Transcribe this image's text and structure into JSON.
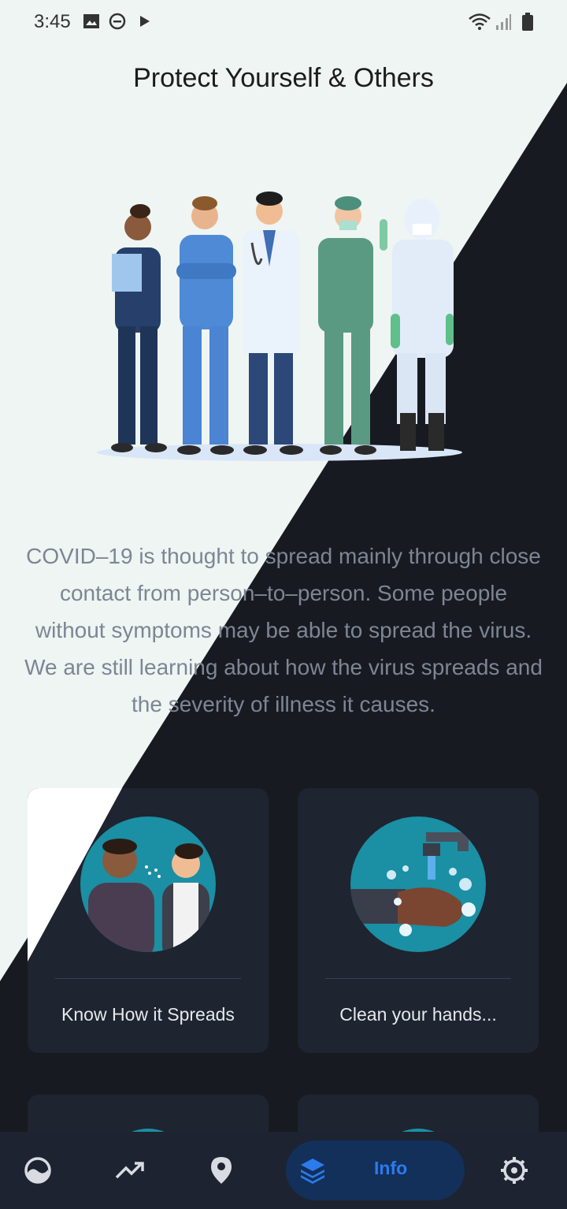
{
  "status_bar": {
    "time": "3:45"
  },
  "page": {
    "title": "Protect Yourself & Others",
    "description": "COVID–19 is thought to spread mainly through close contact from person–to–person. Some people without symptoms may be able to spread the virus. We are still learning about how the virus spreads and the severity of illness it causes."
  },
  "cards": [
    {
      "label": "Know How it Spreads",
      "icon": "people-sneezing-illustration"
    },
    {
      "label": "Clean your hands...",
      "icon": "handwashing-illustration"
    }
  ],
  "nav": {
    "items": [
      {
        "name": "overview",
        "icon": "globe-icon"
      },
      {
        "name": "trends",
        "icon": "trending-up-icon"
      },
      {
        "name": "map",
        "icon": "location-pin-icon"
      },
      {
        "name": "info",
        "icon": "layers-icon",
        "label": "Info",
        "active": true
      },
      {
        "name": "settings",
        "icon": "gear-icon"
      }
    ]
  },
  "colors": {
    "light_bg": "#eef5f2",
    "dark_bg": "#171b21",
    "card_bg": "#1e2430",
    "accent": "#2b7bef",
    "illustration_teal": "#1b8fa3"
  }
}
